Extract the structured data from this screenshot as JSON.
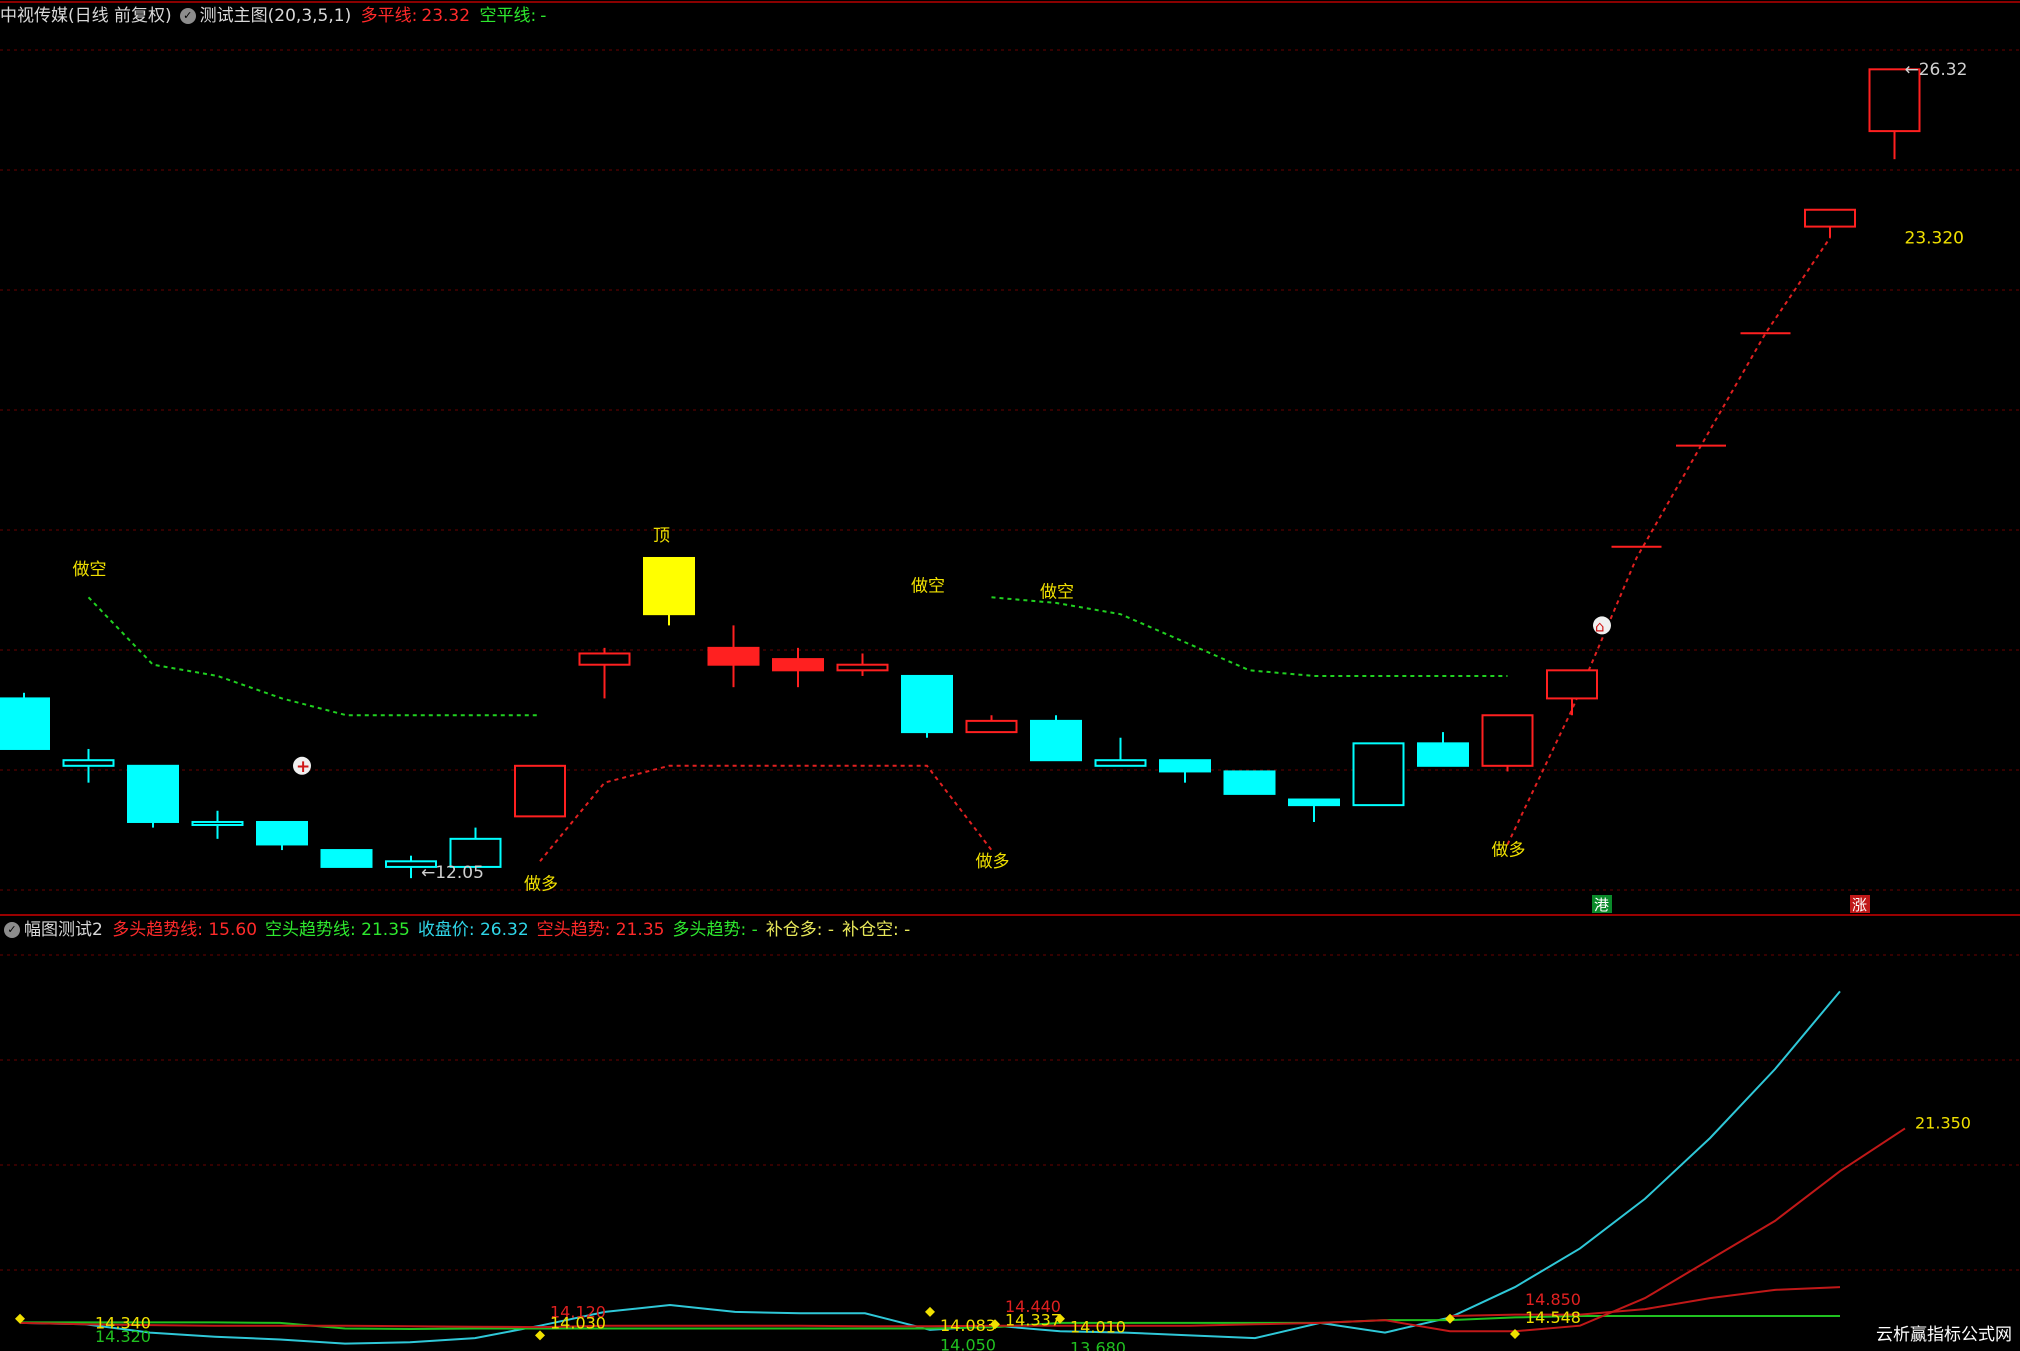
{
  "main_header": {
    "stock": "中视传媒(日线 前复权)",
    "indicator": "测试主图(20,3,5,1)",
    "long_label": "多平线:",
    "long_value": "23.32",
    "short_label": "空平线:",
    "short_value": "-"
  },
  "sub_header": {
    "indicator": "幅图测试2",
    "items": [
      {
        "label": "多头趋势线:",
        "value": "15.60",
        "color": "#ff2a2a"
      },
      {
        "label": "空头趋势线:",
        "value": "21.35",
        "color": "#2ee82e"
      },
      {
        "label": "收盘价:",
        "value": "26.32",
        "color": "#2fd6e8"
      },
      {
        "label": "空头趋势:",
        "value": "21.35",
        "color": "#ff2a2a"
      },
      {
        "label": "多头趋势:",
        "value": "-",
        "color": "#2ee82e"
      },
      {
        "label": "补仓多:",
        "value": "-",
        "color": "#e8e85a"
      },
      {
        "label": "补仓空:",
        "value": "-",
        "color": "#e8e85a"
      }
    ]
  },
  "colors": {
    "up": "#ff2020",
    "down": "#00ffff",
    "top": "#ffff00",
    "grid": "#6a0000",
    "long_line": "#e02020",
    "short_line": "#20d020",
    "text_yellow": "#f0e000"
  },
  "watermark": "云析赢指标公式网",
  "chart_data": [
    {
      "type": "candlestick",
      "y_range": [
        11.6,
        27.0
      ],
      "candles": [
        {
          "o": 15.1,
          "h": 15.2,
          "c": 14.2,
          "l": 14.2,
          "c_style": "down-filled"
        },
        {
          "o": 14.0,
          "h": 14.2,
          "c": 13.9,
          "l": 13.6,
          "c_style": "down-hollow"
        },
        {
          "o": 13.9,
          "h": 13.9,
          "c": 12.9,
          "l": 12.8,
          "c_style": "down-filled"
        },
        {
          "o": 12.9,
          "h": 13.1,
          "c": 12.9,
          "l": 12.6,
          "c_style": "down-hollow"
        },
        {
          "o": 12.9,
          "h": 12.9,
          "c": 12.5,
          "l": 12.4,
          "c_style": "down-filled"
        },
        {
          "o": 12.4,
          "h": 12.4,
          "c": 12.1,
          "l": 12.1,
          "c_style": "down-filled"
        },
        {
          "o": 12.2,
          "h": 12.3,
          "c": 12.1,
          "l": 11.9,
          "c_style": "down-hollow"
        },
        {
          "o": 12.1,
          "h": 12.8,
          "c": 12.6,
          "l": 12.1,
          "c_style": "down-hollow"
        },
        {
          "o": 13.0,
          "h": 13.8,
          "c": 13.9,
          "l": 13.0,
          "c_style": "up-hollow"
        },
        {
          "o": 15.9,
          "h": 16.0,
          "c": 15.7,
          "l": 15.1,
          "c_style": "up-hollow"
        },
        {
          "o": 16.6,
          "h": 17.6,
          "c": 17.6,
          "l": 16.4,
          "c_style": "top"
        },
        {
          "o": 15.7,
          "h": 16.4,
          "c": 16.0,
          "l": 15.3,
          "c_style": "up-filled"
        },
        {
          "o": 15.6,
          "h": 16.0,
          "c": 15.8,
          "l": 15.3,
          "c_style": "up-filled"
        },
        {
          "o": 15.6,
          "h": 15.9,
          "c": 15.7,
          "l": 15.5,
          "c_style": "up-hollow"
        },
        {
          "o": 15.5,
          "h": 15.5,
          "c": 14.5,
          "l": 14.4,
          "c_style": "down-filled"
        },
        {
          "o": 14.5,
          "h": 14.8,
          "c": 14.7,
          "l": 14.5,
          "c_style": "up-hollow"
        },
        {
          "o": 14.7,
          "h": 14.8,
          "c": 14.0,
          "l": 14.0,
          "c_style": "down-filled"
        },
        {
          "o": 14.0,
          "h": 14.4,
          "c": 13.9,
          "l": 13.9,
          "c_style": "down-hollow"
        },
        {
          "o": 14.0,
          "h": 14.0,
          "c": 13.8,
          "l": 13.6,
          "c_style": "down-filled"
        },
        {
          "o": 13.8,
          "h": 13.8,
          "c": 13.4,
          "l": 13.4,
          "c_style": "down-filled"
        },
        {
          "o": 13.3,
          "h": 13.3,
          "c": 13.2,
          "l": 12.9,
          "c_style": "down-filled"
        },
        {
          "o": 14.3,
          "h": 14.3,
          "c": 13.2,
          "l": 13.2,
          "c_style": "down-hollow"
        },
        {
          "o": 14.3,
          "h": 14.5,
          "c": 13.9,
          "l": 13.9,
          "c_style": "down-filled"
        },
        {
          "o": 13.9,
          "h": 14.8,
          "c": 14.8,
          "l": 13.8,
          "c_style": "up-hollow"
        },
        {
          "o": 15.1,
          "h": 15.6,
          "c": 15.6,
          "l": 14.8,
          "c_style": "up-hollow"
        },
        {
          "o": 17.8,
          "h": 17.8,
          "c": 17.8,
          "l": 17.8,
          "c_style": "up-flat"
        },
        {
          "o": 19.6,
          "h": 19.6,
          "c": 19.6,
          "l": 19.6,
          "c_style": "up-flat"
        },
        {
          "o": 21.6,
          "h": 21.6,
          "c": 21.6,
          "l": 21.6,
          "c_style": "up-flat"
        },
        {
          "o": 23.5,
          "h": 23.8,
          "c": 23.8,
          "l": 23.3,
          "c_style": "up-hollow"
        },
        {
          "o": 25.2,
          "h": 26.3,
          "c": 26.3,
          "l": 24.7,
          "c_style": "up-hollow"
        }
      ],
      "long_line": [
        null,
        13.9,
        null,
        null,
        null,
        null,
        null,
        null,
        12.2,
        13.6,
        13.9,
        13.9,
        13.9,
        13.9,
        13.9,
        12.4,
        null,
        null,
        null,
        null,
        null,
        null,
        null,
        12.5,
        14.9,
        17.6,
        19.6,
        21.6,
        23.3,
        null
      ],
      "short_line": [
        null,
        16.9,
        15.7,
        15.5,
        15.1,
        14.8,
        14.8,
        14.8,
        14.8,
        null,
        null,
        null,
        null,
        null,
        null,
        16.9,
        16.8,
        16.6,
        16.1,
        15.6,
        15.5,
        15.5,
        15.5,
        15.5,
        null,
        null,
        null,
        null,
        null,
        null
      ],
      "annotations": [
        {
          "i": 1,
          "y": 17.3,
          "text": "做空"
        },
        {
          "i": 10,
          "y": 17.9,
          "text": "顶"
        },
        {
          "i": 14,
          "y": 17.0,
          "text": "做空"
        },
        {
          "i": 16,
          "y": 16.9,
          "text": "做空"
        },
        {
          "i": 8,
          "y": 11.7,
          "text": "做多"
        },
        {
          "i": 15,
          "y": 12.1,
          "text": "做多"
        },
        {
          "i": 23,
          "y": 12.3,
          "text": "做多"
        }
      ],
      "price_labels": [
        {
          "i": 6,
          "y": 11.9,
          "text": "←12.05",
          "color": "#d0d0d0"
        },
        {
          "i": 29,
          "y": 26.2,
          "text": "←26.32",
          "color": "#d0d0d0"
        },
        {
          "i": 29,
          "y": 23.2,
          "text": "23.320",
          "color": "#f0e000"
        }
      ],
      "bottom_markers": [
        {
          "i": 24,
          "text": "港",
          "bg": "#0a8a2a"
        },
        {
          "i": 28,
          "text": "涨",
          "bg": "#c01818"
        }
      ]
    },
    {
      "type": "line",
      "y_range": [
        13.5,
        28.0
      ],
      "series": [
        {
          "name": "收盘价",
          "color": "#2fc8d8",
          "values": [
            14.3,
            14.25,
            13.95,
            13.8,
            13.7,
            13.55,
            13.6,
            13.75,
            14.2,
            14.7,
            14.95,
            14.7,
            14.65,
            14.65,
            14.05,
            14.2,
            14.0,
            13.95,
            13.85,
            13.75,
            14.3,
            13.95,
            14.5,
            15.6,
            17.0,
            18.8,
            21.0,
            23.5,
            26.32
          ]
        },
        {
          "name": "空头趋势线",
          "color": "#20c020",
          "values": [
            14.32,
            14.32,
            14.32,
            14.32,
            14.3,
            14.1,
            14.08,
            14.1,
            14.1,
            14.1,
            14.1,
            14.1,
            14.1,
            14.1,
            14.1,
            14.15,
            14.3,
            14.3,
            14.3,
            14.3,
            14.3,
            14.4,
            14.4,
            14.5,
            14.55,
            14.55,
            14.55,
            14.55,
            14.55
          ]
        },
        {
          "name": "多头趋势线",
          "color": "#c01818",
          "values": [
            14.3,
            14.25,
            14.22,
            14.2,
            14.2,
            14.2,
            14.18,
            14.16,
            14.15,
            14.2,
            14.2,
            14.2,
            14.2,
            14.18,
            14.18,
            14.2,
            14.2,
            14.2,
            14.2,
            14.25,
            14.3,
            14.4,
            14.0,
            14.0,
            14.2,
            15.2,
            16.6,
            18.0,
            19.8,
            21.35
          ]
        },
        {
          "name": "多头趋势线2",
          "color": "#c01818",
          "values": [
            null,
            null,
            null,
            null,
            null,
            null,
            null,
            null,
            null,
            null,
            null,
            null,
            null,
            null,
            null,
            null,
            null,
            null,
            null,
            null,
            null,
            null,
            14.55,
            14.6,
            14.6,
            14.8,
            15.2,
            15.5,
            15.6
          ]
        }
      ],
      "value_labels": [
        {
          "i": 1,
          "y": 14.1,
          "text": "14.340",
          "color": "#f0e000"
        },
        {
          "i": 1,
          "y": 13.6,
          "text": "14.320",
          "color": "#20c020"
        },
        {
          "i": 8,
          "y": 14.5,
          "text": "14.120",
          "color": "#e02020"
        },
        {
          "i": 8,
          "y": 14.1,
          "text": "14.030",
          "color": "#f0e000"
        },
        {
          "i": 14,
          "y": 14.0,
          "text": "14.083",
          "color": "#f0e000"
        },
        {
          "i": 14,
          "y": 13.3,
          "text": "14.050",
          "color": "#20c020"
        },
        {
          "i": 15,
          "y": 14.2,
          "text": "14.337",
          "color": "#f0e000"
        },
        {
          "i": 15,
          "y": 14.7,
          "text": "14.440",
          "color": "#e02020"
        },
        {
          "i": 16,
          "y": 13.95,
          "text": "14.010",
          "color": "#f0e000"
        },
        {
          "i": 16,
          "y": 13.2,
          "text": "13.680",
          "color": "#20c020"
        },
        {
          "i": 23,
          "y": 14.3,
          "text": "14.548",
          "color": "#f0e000"
        },
        {
          "i": 23,
          "y": 14.95,
          "text": "14.850",
          "color": "#e02020"
        },
        {
          "i": 29,
          "y": 21.35,
          "text": "21.350",
          "color": "#f0e000"
        }
      ],
      "dots": [
        {
          "i": 0,
          "y": 14.45
        },
        {
          "i": 8,
          "y": 13.85
        },
        {
          "i": 14,
          "y": 14.7
        },
        {
          "i": 15,
          "y": 14.25
        },
        {
          "i": 16,
          "y": 14.45
        },
        {
          "i": 22,
          "y": 14.45
        },
        {
          "i": 23,
          "y": 13.9
        }
      ]
    }
  ]
}
